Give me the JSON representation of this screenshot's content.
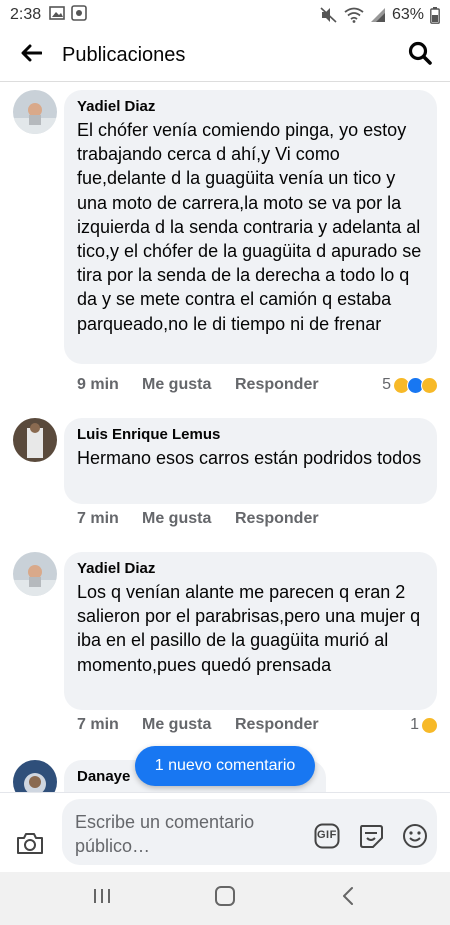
{
  "status_bar": {
    "time": "2:38",
    "battery": "63%"
  },
  "header": {
    "title": "Publicaciones"
  },
  "comments": [
    {
      "author": "Yadiel Diaz",
      "text": "El chófer venía comiendo pinga, yo estoy trabajando cerca d ahí,y Vi como fue,delante d la guagüita venía un tico y una moto de carrera,la moto se va por la izquierda d la senda contraria y adelanta al tico,y el chófer de la guagüita d apurado se tira por la senda de la derecha a todo lo q da y se mete contra el camión q estaba parqueado,no le di tiempo ni de frenar",
      "time": "9 min",
      "like_label": "Me gusta",
      "reply_label": "Responder",
      "reaction_count": "5",
      "reactions": [
        "wow",
        "like",
        "sad"
      ]
    },
    {
      "author": "Luis Enrique Lemus",
      "text": "Hermano esos carros están podridos todos",
      "time": "7 min",
      "like_label": "Me gusta",
      "reply_label": "Responder",
      "reaction_count": "",
      "reactions": []
    },
    {
      "author": "Yadiel Diaz",
      "text": "Los q venían alante me parecen q eran 2 salieron por el parabrisas,pero una mujer q iba en el pasillo de la guagüita murió al momento,pues quedó prensada",
      "time": "7 min",
      "like_label": "Me gusta",
      "reply_label": "Responder",
      "reaction_count": "1",
      "reactions": [
        "sad"
      ]
    },
    {
      "author": "Danaye",
      "text": "",
      "time": "",
      "like_label": "",
      "reply_label": "",
      "reaction_count": "",
      "reactions": []
    }
  ],
  "new_comment_pill": "1 nuevo comentario",
  "composer": {
    "placeholder": "Escribe un comentario público…",
    "gif_label": "GIF"
  },
  "colors": {
    "accent": "#1877f2",
    "bubble": "#f0f2f5",
    "secondary_text": "#65676b"
  },
  "icons": [
    "back-arrow-icon",
    "search-icon",
    "camera-icon",
    "gif-icon",
    "sticker-icon",
    "emoji-icon",
    "nav-recents-icon",
    "nav-home-icon",
    "nav-back-icon"
  ]
}
